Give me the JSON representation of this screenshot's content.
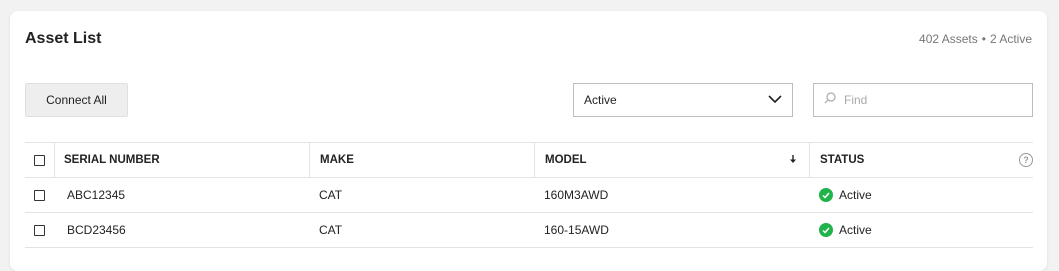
{
  "header": {
    "title": "Asset List",
    "asset_count": "402 Assets",
    "separator": "•",
    "active_count": "2 Active"
  },
  "toolbar": {
    "connect_all_label": "Connect All",
    "filter_selected": "Active",
    "search_placeholder": "Find"
  },
  "table": {
    "columns": [
      "SERIAL NUMBER",
      "MAKE",
      "MODEL",
      "STATUS"
    ],
    "sort_icon": "arrow-down-icon",
    "rows": [
      {
        "serial": "ABC12345",
        "make": "CAT",
        "model": "160M3AWD",
        "status": "Active"
      },
      {
        "serial": "BCD23456",
        "make": "CAT",
        "model": "160-15AWD",
        "status": "Active"
      }
    ]
  },
  "colors": {
    "status_active": "#1fb34a",
    "background": "#f2f2f2",
    "card": "#ffffff"
  }
}
